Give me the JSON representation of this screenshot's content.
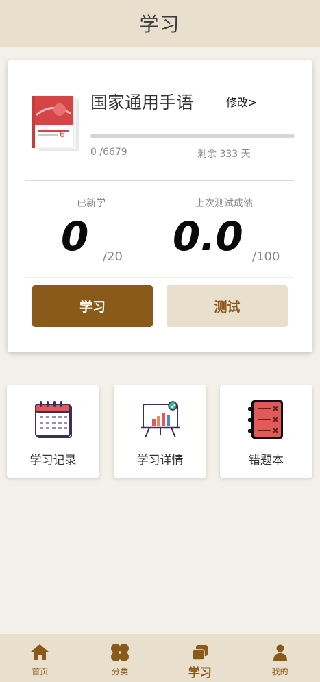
{
  "header": {
    "title": "学习"
  },
  "course": {
    "name": "国家通用手语",
    "edit_label": "修改>",
    "progress_text": "0 /6679",
    "progress_fraction": 0,
    "remaining_text": "剩余 333 天"
  },
  "stats": {
    "learned_label": "已新学",
    "learned_value": "0",
    "learned_total": "/20",
    "score_label": "上次测试成绩",
    "score_value": "0.0",
    "score_total": "/100"
  },
  "actions": {
    "study_label": "学习",
    "test_label": "测试"
  },
  "tiles": [
    {
      "label": "学习记录",
      "icon": "calendar-icon"
    },
    {
      "label": "学习详情",
      "icon": "presentation-chart-icon"
    },
    {
      "label": "错题本",
      "icon": "wrong-notebook-icon"
    }
  ],
  "tabs": [
    {
      "label": "首页",
      "icon": "home-icon"
    },
    {
      "label": "分类",
      "icon": "category-icon"
    },
    {
      "label": "学习",
      "icon": "study-icon",
      "active": true
    },
    {
      "label": "我的",
      "icon": "user-icon"
    }
  ],
  "colors": {
    "accent": "#8a5a1a",
    "accent_light": "#e9dfcd",
    "background": "#f3f0e9"
  }
}
